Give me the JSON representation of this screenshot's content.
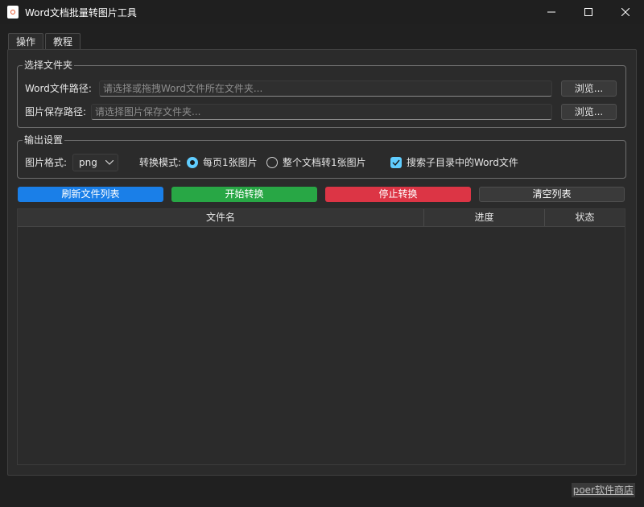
{
  "window": {
    "title": "Word文档批量转图片工具",
    "icon": "word-doc-icon"
  },
  "tabs": [
    {
      "label": "操作",
      "active": true
    },
    {
      "label": "教程",
      "active": false
    }
  ],
  "folder_group": {
    "title": "选择文件夹",
    "word_path": {
      "label": "Word文件路径:",
      "placeholder": "请选择或拖拽Word文件所在文件夹...",
      "value": "",
      "browse_label": "浏览..."
    },
    "image_path": {
      "label": "图片保存路径:",
      "placeholder": "请选择图片保存文件夹...",
      "value": "",
      "browse_label": "浏览..."
    }
  },
  "output_group": {
    "title": "输出设置",
    "format_label": "图片格式:",
    "format_value": "png",
    "mode_label": "转换模式:",
    "mode_options": [
      {
        "label": "每页1张图片",
        "selected": true
      },
      {
        "label": "整个文档转1张图片",
        "selected": false
      }
    ],
    "subdir_label": "搜索子目录中的Word文件",
    "subdir_checked": true
  },
  "actions": {
    "refresh": "刷新文件列表",
    "start": "开始转换",
    "stop": "停止转换",
    "clear": "清空列表"
  },
  "table": {
    "columns": [
      "文件名",
      "进度",
      "状态"
    ],
    "rows": []
  },
  "footer": {
    "link": "poer软件商店"
  },
  "colors": {
    "accent": "#60cdff",
    "refresh": "#1a7fe8",
    "start": "#28a745",
    "stop": "#dc3545",
    "clear": "#3a3a3a"
  }
}
